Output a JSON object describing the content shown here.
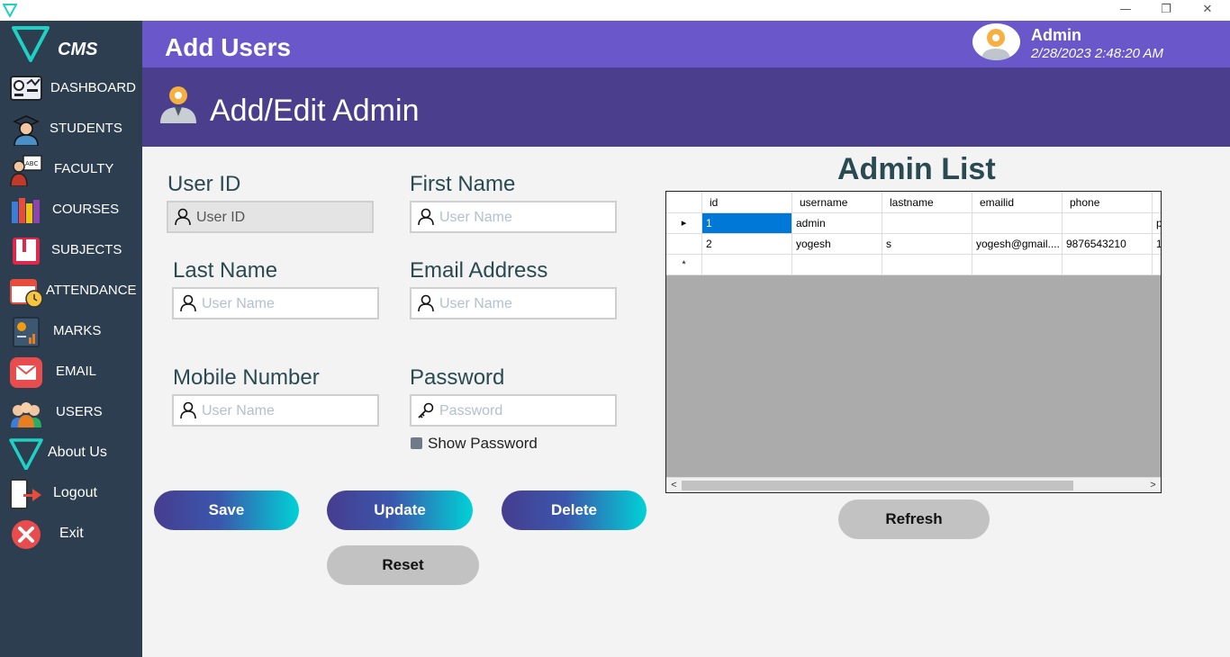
{
  "window": {
    "min_icon": "minimize-icon",
    "max_icon": "restore-icon",
    "close_icon": "close-icon",
    "min": "—",
    "max": "❐",
    "close": "✕"
  },
  "brand": {
    "name": "CMS"
  },
  "sidebar": {
    "items": [
      {
        "label": "DASHBOARD",
        "icon": "dashboard-icon"
      },
      {
        "label": "STUDENTS",
        "icon": "student-icon"
      },
      {
        "label": "FACULTY",
        "icon": "faculty-icon"
      },
      {
        "label": "COURSES",
        "icon": "books-icon"
      },
      {
        "label": "SUBJECTS",
        "icon": "book-icon"
      },
      {
        "label": "ATTENDANCE",
        "icon": "calendar-icon"
      },
      {
        "label": "MARKS",
        "icon": "report-icon"
      },
      {
        "label": "EMAIL",
        "icon": "mail-icon"
      },
      {
        "label": "USERS",
        "icon": "users-icon"
      },
      {
        "label": "About Us",
        "icon": "logo-icon"
      },
      {
        "label": "Logout",
        "icon": "logout-icon"
      },
      {
        "label": "Exit",
        "icon": "exit-icon"
      }
    ]
  },
  "header": {
    "title": "Add Users",
    "user": "Admin",
    "datetime": "2/28/2023 2:48:20 AM"
  },
  "subheader": {
    "title": "Add/Edit Admin"
  },
  "form": {
    "user_id": {
      "label": "User ID",
      "placeholder": "User ID"
    },
    "first_name": {
      "label": "First Name",
      "placeholder": "User Name"
    },
    "last_name": {
      "label": "Last Name",
      "placeholder": "User Name"
    },
    "email": {
      "label": "Email Address",
      "placeholder": "User Name"
    },
    "mobile": {
      "label": "Mobile Number",
      "placeholder": "User Name"
    },
    "password": {
      "label": "Password",
      "placeholder": "Password"
    },
    "show_password": "Show Password"
  },
  "buttons": {
    "save": "Save",
    "update": "Update",
    "delete": "Delete",
    "reset": "Reset",
    "refresh": "Refresh"
  },
  "admin_list": {
    "title": "Admin List",
    "columns": [
      "id",
      "username",
      "lastname",
      "emailid",
      "phone"
    ],
    "rows": [
      {
        "marker": "▸",
        "id": "1",
        "username": "admin",
        "lastname": "",
        "emailid": "",
        "phone": "",
        "extra": "p"
      },
      {
        "marker": "",
        "id": "2",
        "username": "yogesh",
        "lastname": "s",
        "emailid": "yogesh@gmail....",
        "phone": "9876543210",
        "extra": "1"
      },
      {
        "marker": "*",
        "id": "",
        "username": "",
        "lastname": "",
        "emailid": "",
        "phone": "",
        "extra": ""
      }
    ],
    "scroll_left": "<",
    "scroll_right": ">"
  },
  "colors": {
    "topbar": "#6a57c9",
    "subheader": "#4b3e8c",
    "sidebar": "#2d3e50",
    "selected": "#0078d7"
  }
}
